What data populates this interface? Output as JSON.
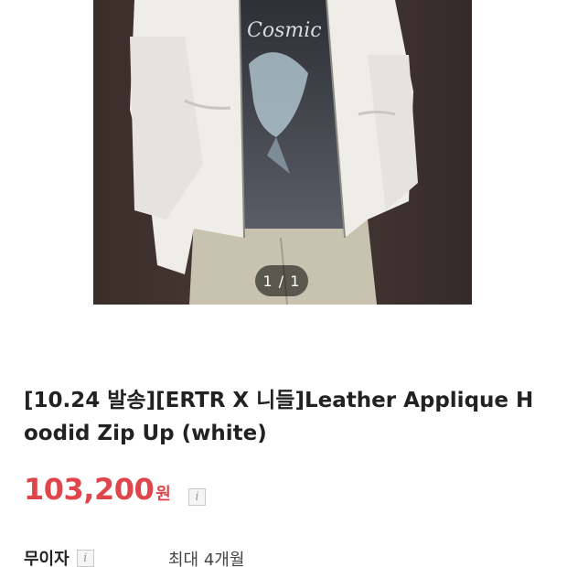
{
  "gallery": {
    "counter": "1 / 1",
    "image_alt": "white zip-up hoodie worn over black graphic t-shirt"
  },
  "product": {
    "title": "[10.24 발송][ERTR X 니들]Leather Applique Hoodid Zip Up (white)",
    "price": "103,200",
    "price_unit": "원",
    "price_info_icon": "i"
  },
  "installment": {
    "label": "무이자",
    "info_icon": "i",
    "value": "최대 4개월"
  },
  "colors": {
    "price": "#e0454b",
    "text": "#222222"
  }
}
